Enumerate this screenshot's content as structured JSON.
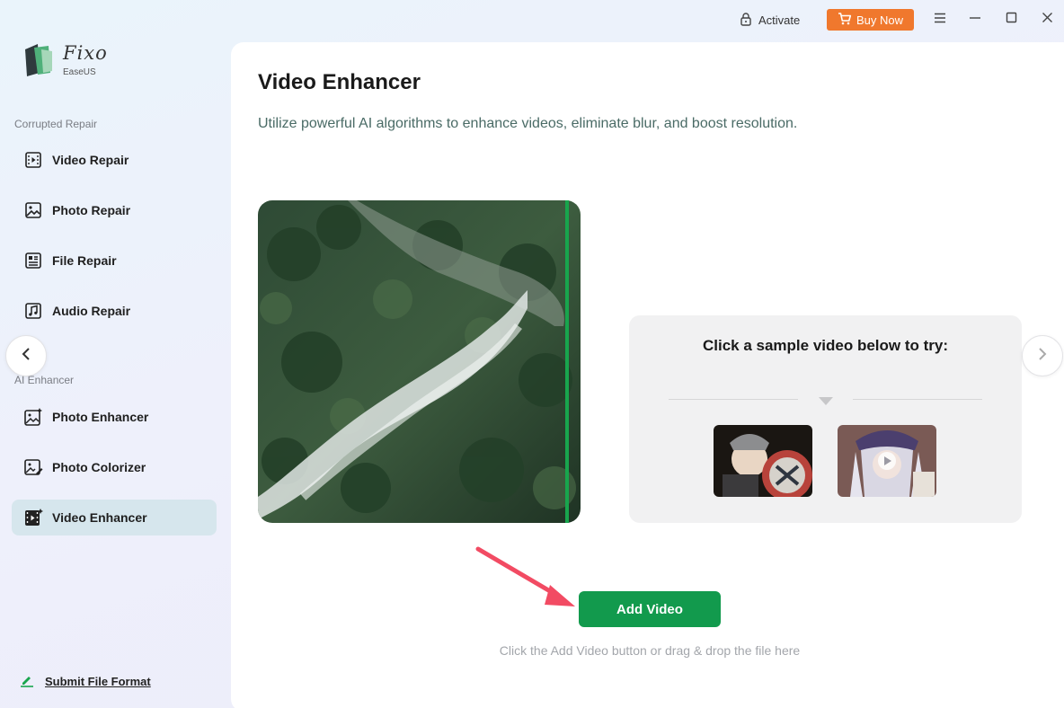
{
  "titlebar": {
    "activate_label": "Activate",
    "buy_now_label": "Buy Now",
    "accent_color": "#f0782d"
  },
  "logo": {
    "name": "Fixo",
    "sub": "EaseUS"
  },
  "sidebar": {
    "sections": [
      {
        "label": "Corrupted Repair",
        "items": [
          {
            "label": "Video Repair",
            "icon": "video-frame-icon"
          },
          {
            "label": "Photo Repair",
            "icon": "image-icon"
          },
          {
            "label": "File Repair",
            "icon": "document-icon"
          },
          {
            "label": "Audio Repair",
            "icon": "music-note-icon"
          }
        ]
      },
      {
        "label": "AI Enhancer",
        "items": [
          {
            "label": "Photo Enhancer",
            "icon": "image-sparkle-icon"
          },
          {
            "label": "Photo Colorizer",
            "icon": "image-palette-icon"
          },
          {
            "label": "Video Enhancer",
            "icon": "video-sparkle-icon",
            "active": true
          }
        ]
      }
    ],
    "submit_label": "Submit File Format"
  },
  "main": {
    "title": "Video Enhancer",
    "description": "Utilize powerful AI algorithms to enhance videos, eliminate blur, and boost resolution.",
    "sample_title": "Click a sample video below to try:",
    "add_button_label": "Add Video",
    "hint": "Click the Add Video button or drag & drop the file here",
    "primary_color": "#129a4d"
  }
}
